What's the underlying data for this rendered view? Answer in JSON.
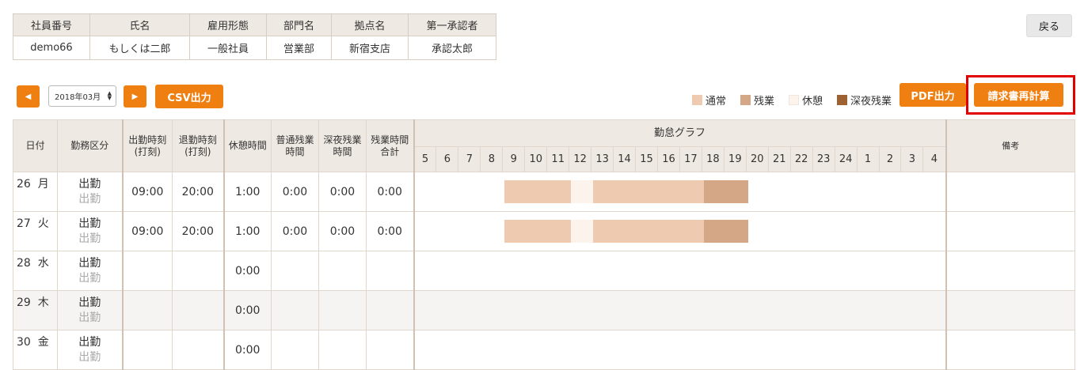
{
  "employee": {
    "headers": [
      "社員番号",
      "氏名",
      "雇用形態",
      "部門名",
      "拠点名",
      "第一承認者"
    ],
    "values": [
      "demo66",
      "もしくは二郎",
      "一般社員",
      "営業部",
      "新宿支店",
      "承認太郎"
    ]
  },
  "back_label": "戻る",
  "toolbar": {
    "prev_icon": "◀",
    "next_icon": "▶",
    "month": "2018年03月",
    "csv_label": "CSV出力",
    "pdf_label": "PDF出力",
    "recalc_label": "請求書再計算"
  },
  "legend": [
    {
      "label": "通常",
      "color": "#edcab0"
    },
    {
      "label": "残業",
      "color": "#d4a886"
    },
    {
      "label": "休憩",
      "color": "#fbf3ec"
    },
    {
      "label": "深夜残業",
      "color": "#9e6232"
    }
  ],
  "table": {
    "headers": {
      "date": "日付",
      "kubun": "勤務区分",
      "start": [
        "出勤時刻",
        "(打刻)"
      ],
      "end": [
        "退勤時刻",
        "(打刻)"
      ],
      "break": "休憩時間",
      "ot": [
        "普通残業",
        "時間"
      ],
      "night": [
        "深夜残業",
        "時間"
      ],
      "total": [
        "残業時間",
        "合計"
      ],
      "graph": "勤怠グラフ",
      "memo": "備考",
      "hours": [
        "5",
        "6",
        "7",
        "8",
        "9",
        "10",
        "11",
        "12",
        "13",
        "14",
        "15",
        "16",
        "17",
        "18",
        "19",
        "20",
        "21",
        "22",
        "23",
        "24",
        "1",
        "2",
        "3",
        "4"
      ]
    },
    "rows": [
      {
        "day": "26",
        "weekday": "月",
        "kubun": "出勤",
        "kubun_sub": "出勤",
        "start": "09:00",
        "end": "20:00",
        "break": "1:00",
        "ot": "0:00",
        "night": "0:00",
        "total": "0:00",
        "segments": [
          {
            "from": 9,
            "to": 12,
            "type": "normal"
          },
          {
            "from": 12,
            "to": 13,
            "type": "break"
          },
          {
            "from": 13,
            "to": 18,
            "type": "normal"
          },
          {
            "from": 18,
            "to": 20,
            "type": "overtime"
          }
        ]
      },
      {
        "day": "27",
        "weekday": "火",
        "kubun": "出勤",
        "kubun_sub": "出勤",
        "start": "09:00",
        "end": "20:00",
        "break": "1:00",
        "ot": "0:00",
        "night": "0:00",
        "total": "0:00",
        "segments": [
          {
            "from": 9,
            "to": 12,
            "type": "normal"
          },
          {
            "from": 12,
            "to": 13,
            "type": "break"
          },
          {
            "from": 13,
            "to": 18,
            "type": "normal"
          },
          {
            "from": 18,
            "to": 20,
            "type": "overtime"
          }
        ]
      },
      {
        "day": "28",
        "weekday": "水",
        "kubun": "出勤",
        "kubun_sub": "出勤",
        "start": "",
        "end": "",
        "break": "0:00",
        "ot": "",
        "night": "",
        "total": "",
        "segments": []
      },
      {
        "day": "29",
        "weekday": "木",
        "kubun": "出勤",
        "kubun_sub": "出勤",
        "start": "",
        "end": "",
        "break": "0:00",
        "ot": "",
        "night": "",
        "total": "",
        "segments": []
      },
      {
        "day": "30",
        "weekday": "金",
        "kubun": "出勤",
        "kubun_sub": "出勤",
        "start": "",
        "end": "",
        "break": "0:00",
        "ot": "",
        "night": "",
        "total": "",
        "segments": []
      }
    ]
  }
}
